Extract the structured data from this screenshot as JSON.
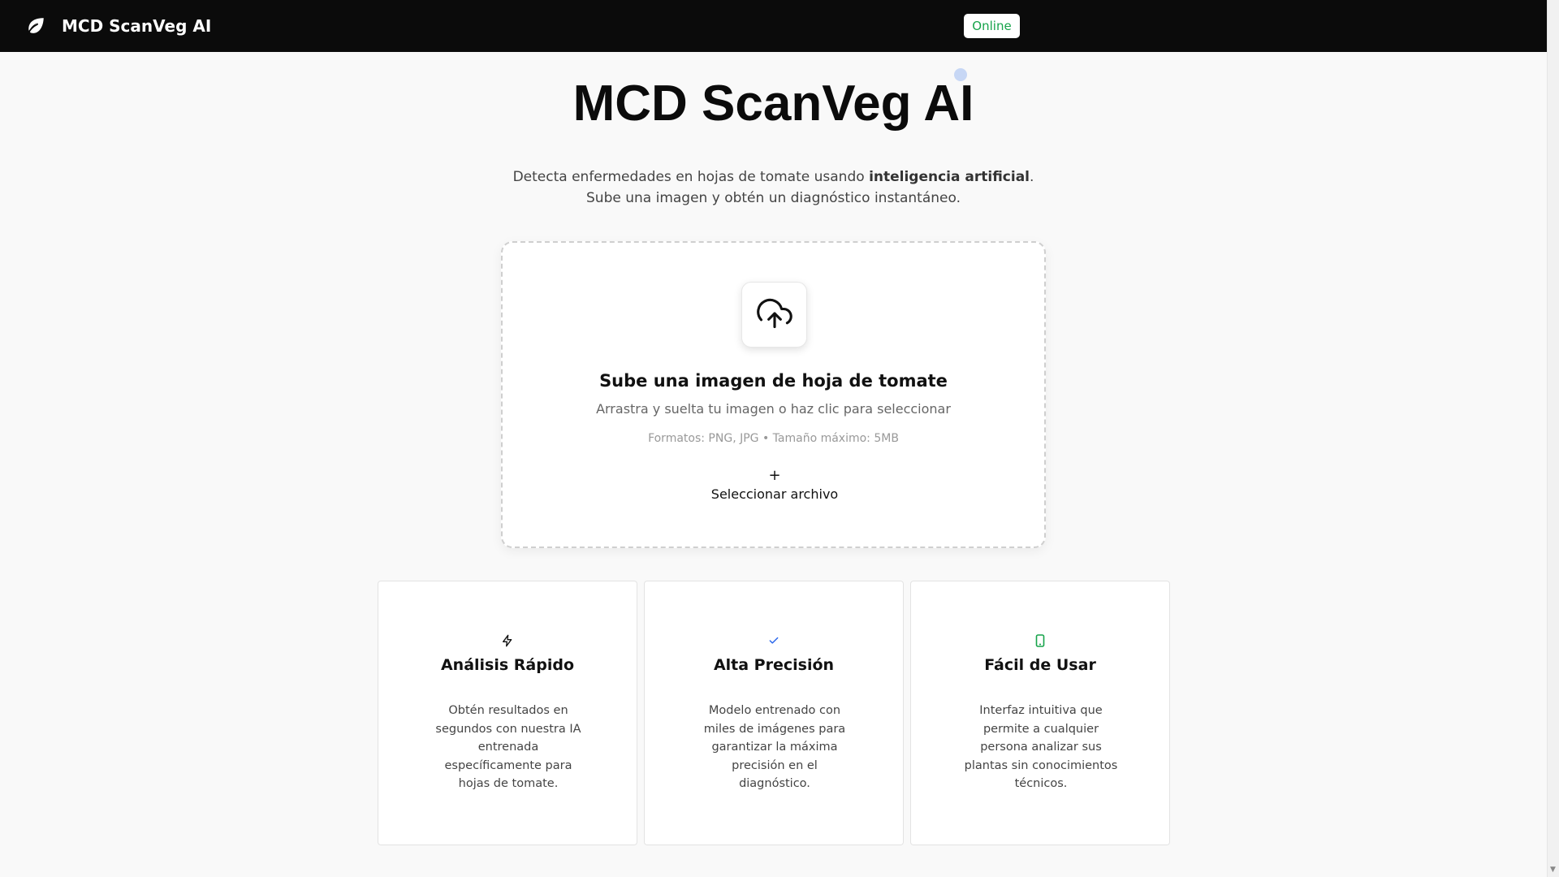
{
  "colors": {
    "navbar_bg": "#0b0b0b",
    "status_online": "#16a34a",
    "accent_blue": "#2563eb",
    "accent_green": "#16a34a"
  },
  "navbar": {
    "logo_icon": "leaf-icon",
    "title": "MCD ScanVeg AI",
    "status": "Online"
  },
  "hero": {
    "title": "MCD ScanVeg AI",
    "subtitle_part1": "Detecta enfermedades en hojas de tomate usando ",
    "subtitle_bold": "inteligencia artificial",
    "subtitle_part2": ".",
    "subtitle_line2": "Sube una imagen y obtén un diagnóstico instantáneo."
  },
  "upload": {
    "icon": "cloud-upload-icon",
    "heading": "Sube una imagen de hoja de tomate",
    "description": "Arrastra y suelta tu imagen o haz clic para seleccionar",
    "formats": "Formatos: PNG, JPG • Tamaño máximo: 5MB",
    "button_symbol": "+",
    "button_label": "Seleccionar archivo"
  },
  "features": [
    {
      "icon": "lightning-icon",
      "title": "Análisis Rápido",
      "description": "Obtén resultados en segundos con nuestra IA entrenada específicamente para hojas de tomate."
    },
    {
      "icon": "check-icon",
      "title": "Alta Precisión",
      "description": "Modelo entrenado con miles de imágenes para garantizar la máxima precisión en el diagnóstico."
    },
    {
      "icon": "mobile-icon",
      "title": "Fácil de Usar",
      "description": "Interfaz intuitiva que permite a cualquier persona analizar sus plantas sin conocimientos técnicos."
    }
  ]
}
